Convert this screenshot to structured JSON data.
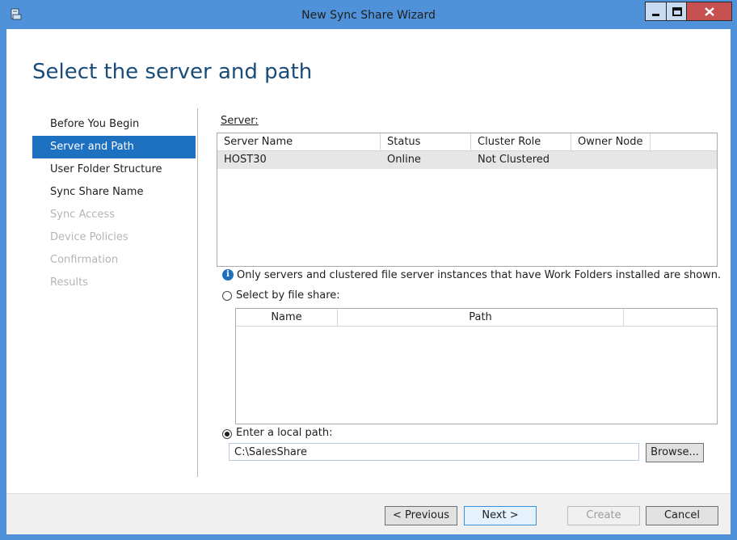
{
  "window": {
    "title": "New Sync Share Wizard",
    "accent": "#4f92d9"
  },
  "page": {
    "heading": "Select the server and path"
  },
  "nav": {
    "items": [
      {
        "label": "Before You Begin",
        "state": "normal"
      },
      {
        "label": "Server and Path",
        "state": "active"
      },
      {
        "label": "User Folder Structure",
        "state": "normal"
      },
      {
        "label": "Sync Share Name",
        "state": "normal"
      },
      {
        "label": "Sync Access",
        "state": "disabled"
      },
      {
        "label": "Device Policies",
        "state": "disabled"
      },
      {
        "label": "Confirmation",
        "state": "disabled"
      },
      {
        "label": "Results",
        "state": "disabled"
      }
    ]
  },
  "server": {
    "label": "Server:",
    "columns": [
      "Server Name",
      "Status",
      "Cluster Role",
      "Owner Node"
    ],
    "rows": [
      {
        "name": "HOST30",
        "status": "Online",
        "cluster_role": "Not Clustered",
        "owner_node": ""
      }
    ],
    "info_text": "Only servers and clustered file server instances that have Work Folders installed are shown."
  },
  "file_share": {
    "radio_label": "Select by file share:",
    "selected": false,
    "columns": [
      "Name",
      "Path"
    ]
  },
  "local_path": {
    "radio_label": "Enter a local path:",
    "selected": true,
    "value": "C:\\SalesShare",
    "browse_label": "Browse..."
  },
  "footer": {
    "previous_label": "< Previous",
    "next_label": "Next >",
    "create_label": "Create",
    "cancel_label": "Cancel"
  },
  "icons": {
    "app": "wizard-app-icon",
    "minimize": "minimize-icon",
    "maximize": "maximize-icon",
    "close": "close-icon",
    "info": "info-icon"
  }
}
